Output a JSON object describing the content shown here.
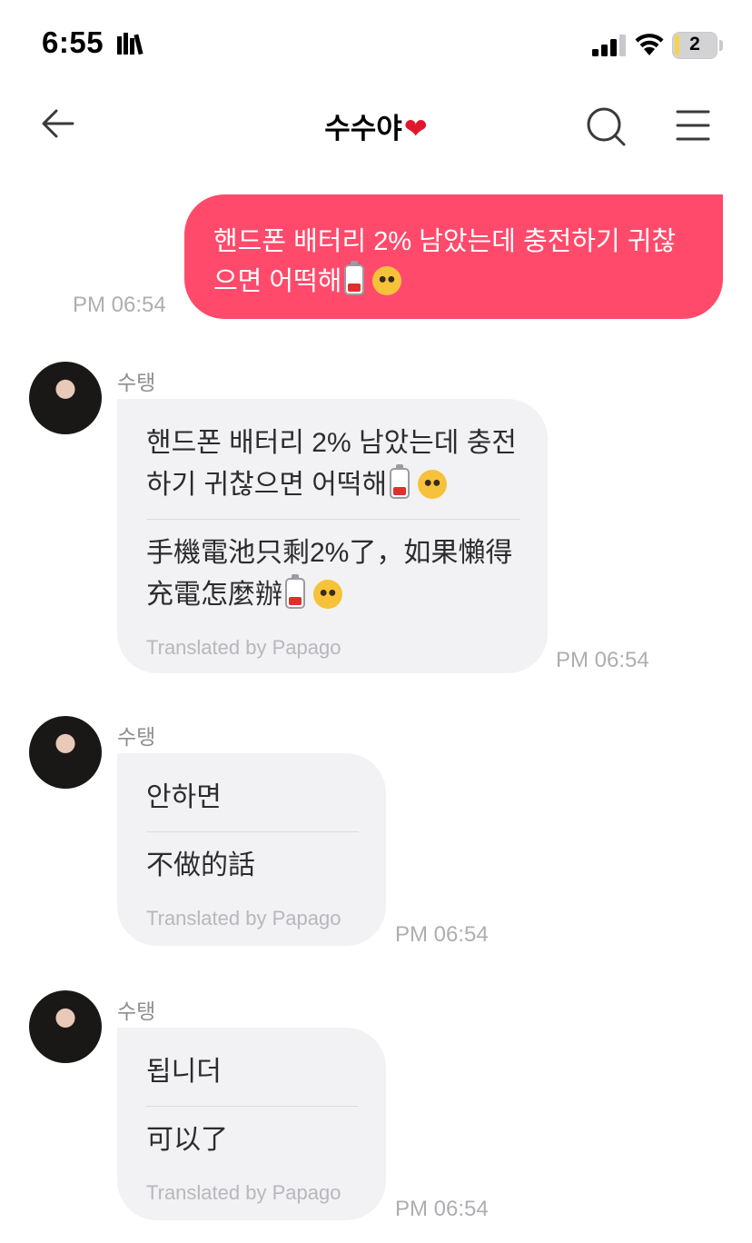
{
  "status_bar": {
    "time": "6:55",
    "battery_level": "2",
    "battery_color": "#f5d44a"
  },
  "header": {
    "title": "수수야",
    "title_heart": "❤"
  },
  "accent": "#ff4a6b",
  "messages": [
    {
      "direction": "out",
      "text_line1": "핸드폰 배터리 2% 남았는데 충전하기 귀찮",
      "text_line2": "으면 어떡해",
      "time": "PM 06:54"
    },
    {
      "direction": "in",
      "sender": "수탱",
      "original_line1": "핸드폰 배터리 2% 남았는데 충전",
      "original_line2": "하기 귀찮으면 어떡해",
      "translation_line1": "手機電池只剩2%了，如果懶得",
      "translation_line2": "充電怎麼辦",
      "translated_by": "Translated by Papago",
      "time": "PM 06:54"
    },
    {
      "direction": "in",
      "sender": "수탱",
      "original": "안하면",
      "translation": "不做的話",
      "translated_by": "Translated by Papago",
      "time": "PM 06:54"
    },
    {
      "direction": "in",
      "sender": "수탱",
      "original": "됩니더",
      "translation": "可以了",
      "translated_by": "Translated by Papago",
      "time": "PM 06:54"
    }
  ]
}
